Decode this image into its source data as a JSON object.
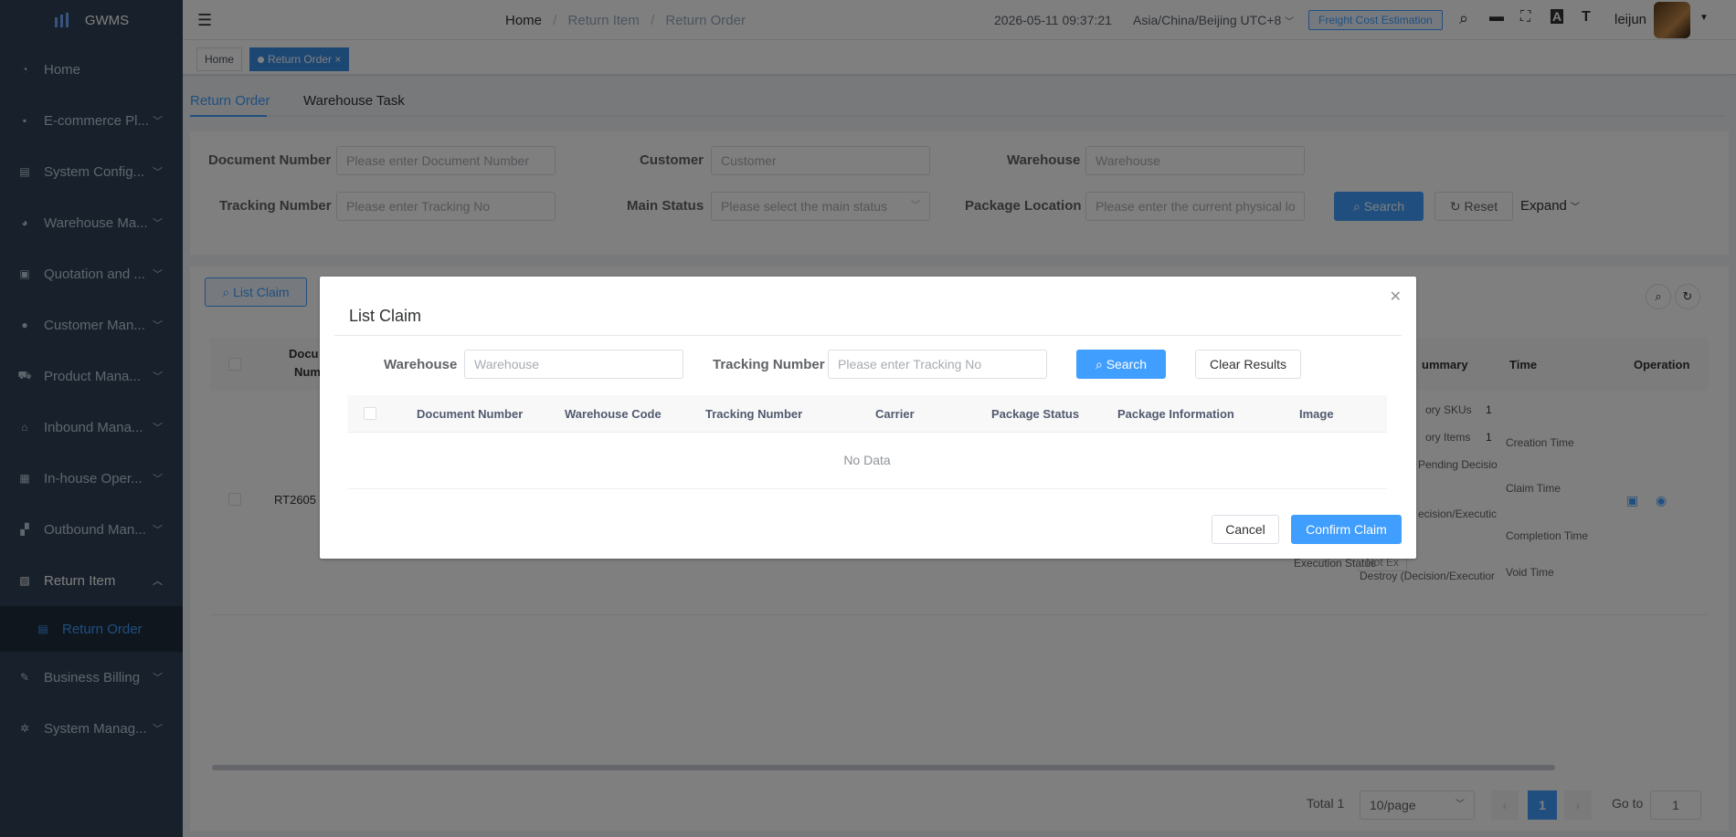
{
  "app": {
    "name": "GWMS"
  },
  "sidebar": {
    "items": [
      {
        "label": "Home",
        "icon": "dashboard-icon"
      },
      {
        "label": "E-commerce Pl...",
        "icon": "shop-icon"
      },
      {
        "label": "System Config...",
        "icon": "config-icon"
      },
      {
        "label": "Warehouse Ma...",
        "icon": "warehouse-icon"
      },
      {
        "label": "Quotation and ...",
        "icon": "quotation-icon"
      },
      {
        "label": "Customer Man...",
        "icon": "user-icon"
      },
      {
        "label": "Product Mana...",
        "icon": "cart-icon"
      },
      {
        "label": "Inbound Mana...",
        "icon": "inbound-icon"
      },
      {
        "label": "In-house Oper...",
        "icon": "grid-icon"
      },
      {
        "label": "Outbound Man...",
        "icon": "apps-icon"
      },
      {
        "label": "Return Item",
        "icon": "return-icon"
      },
      {
        "label": "Return Order",
        "icon": "document-icon"
      },
      {
        "label": "Business Billing",
        "icon": "billing-icon"
      },
      {
        "label": "System Manag...",
        "icon": "settings-icon"
      }
    ]
  },
  "header": {
    "breadcrumb": [
      "Home",
      "Return Item",
      "Return Order"
    ],
    "datetime": "2026-05-11 09:37:21",
    "timezone": "Asia/China/Beijing UTC+8",
    "freight_button": "Freight Cost Estimation",
    "username": "leijun"
  },
  "tags": {
    "home": "Home",
    "active": "Return Order"
  },
  "tabs": [
    "Return Order",
    "Warehouse Task"
  ],
  "filters": {
    "document_number": {
      "label": "Document Number",
      "placeholder": "Please enter Document Number"
    },
    "customer": {
      "label": "Customer",
      "placeholder": "Customer"
    },
    "warehouse": {
      "label": "Warehouse",
      "placeholder": "Warehouse"
    },
    "tracking_number": {
      "label": "Tracking Number",
      "placeholder": "Please enter Tracking No"
    },
    "main_status": {
      "label": "Main Status",
      "placeholder": "Please select the main status"
    },
    "package_location": {
      "label": "Package Location",
      "placeholder": "Please enter the current physical lo"
    },
    "search": "Search",
    "reset": "Reset",
    "expand": "Expand"
  },
  "table": {
    "list_claim_button": "List Claim",
    "header_partial": [
      "Docu",
      "Num",
      "ummary",
      "Time",
      "Operation"
    ],
    "row_doc_partial": "RT2605",
    "summary": [
      "ory SKUs",
      "1",
      "ory Items",
      "1",
      "Pending Decisio",
      "ecision/Executic",
      "Destroy (Decision/Executior"
    ],
    "execution_status_label": "Execution Status",
    "execution_status_value": "Not Ex",
    "times": [
      "Creation Time",
      "Claim Time",
      "Completion Time",
      "Void Time"
    ]
  },
  "pagination": {
    "total": "Total 1",
    "page_size": "10/page",
    "current_page": "1",
    "goto_label": "Go to",
    "goto_value": "1"
  },
  "dialog": {
    "title": "List Claim",
    "warehouse_label": "Warehouse",
    "warehouse_placeholder": "Warehouse",
    "tracking_label": "Tracking Number",
    "tracking_placeholder": "Please enter Tracking No",
    "search": "Search",
    "clear": "Clear Results",
    "columns": [
      "Document Number",
      "Warehouse Code",
      "Tracking Number",
      "Carrier",
      "Package Status",
      "Package Information",
      "Image"
    ],
    "empty_text": "No Data",
    "cancel": "Cancel",
    "confirm": "Confirm Claim"
  },
  "colors": {
    "primary": "#409eff",
    "sidebar": "#304156",
    "overlay": "rgba(0,0,0,0.5)"
  }
}
